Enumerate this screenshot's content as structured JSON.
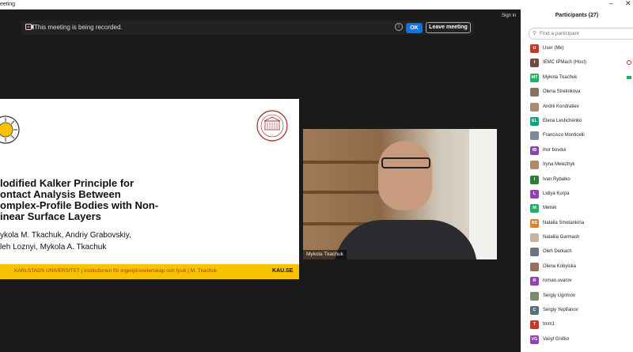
{
  "window": {
    "title": "eeting"
  },
  "toolbar": {
    "signin_label": "Sign in"
  },
  "recording_banner": {
    "text": "This meeting is being recorded.",
    "info_label": "i",
    "ok_label": "OK",
    "leave_label": "Leave meeting"
  },
  "slide": {
    "title": "lodified Kalker Principle for\nontact Analysis Between\nomplex-Profile Bodies with Non-\ninear Surface Layers",
    "authors": "ykola M. Tkachuk, Andriy Grabovskiy,\nleh Loznyi, Mykola A. Tkachuk",
    "footer_text": "KARLSTADS UNIVERSITET  |  Institutionen för ingenjörsvetenskap och fysik  |  M. Tkachuk",
    "footer_brand": "KAU.SE"
  },
  "video": {
    "name": "Mykola Tkachuk"
  },
  "participants": {
    "title": "Participants (27)",
    "search_placeholder": "Find a participant",
    "items": [
      {
        "initials": "U",
        "name": "User (Me)",
        "color": "#c0392b"
      },
      {
        "initials": "I",
        "name": "IEMC IPMach (Host)",
        "color": "#6d4c41"
      },
      {
        "initials": "MT",
        "name": "Mykola Tkachuk",
        "color": "#27ae60"
      },
      {
        "initials": "",
        "name": "Olena Strelnikova",
        "color": "#8e6f5a"
      },
      {
        "initials": "",
        "name": "Andrii Kondratiev",
        "color": "#a98c73"
      },
      {
        "initials": "EL",
        "name": "Elena Leshchenko",
        "color": "#16a085"
      },
      {
        "initials": "",
        "name": "Francisco Monticelli",
        "color": "#7b8a99"
      },
      {
        "initials": "IB",
        "name": "ihor bovdui",
        "color": "#8e44ad"
      },
      {
        "initials": "",
        "name": "Iryna Melezhyk",
        "color": "#b08968"
      },
      {
        "initials": "I",
        "name": "Ivan Rybalko",
        "color": "#2e7d32"
      },
      {
        "initials": "L",
        "name": "Lidiya Kurpa",
        "color": "#8e44ad"
      },
      {
        "initials": "M",
        "name": "Melnik",
        "color": "#27ae60"
      },
      {
        "initials": "NS",
        "name": "Natalia Smetankina",
        "color": "#e67e22"
      },
      {
        "initials": "",
        "name": "Nataliia Garmash",
        "color": "#c9b29b"
      },
      {
        "initials": "",
        "name": "Oleh Derkach",
        "color": "#6a7680"
      },
      {
        "initials": "",
        "name": "Olena Kobylska",
        "color": "#9a6f5a"
      },
      {
        "initials": "R",
        "name": "roman.uvarov",
        "color": "#8e44ad"
      },
      {
        "initials": "",
        "name": "Sergiy Ugrimov",
        "color": "#7a8c6b"
      },
      {
        "initials": "C",
        "name": "Sergiy Yepifanov",
        "color": "#546e7a"
      },
      {
        "initials": "T",
        "name": "tmm1",
        "color": "#c0392b"
      },
      {
        "initials": "VG",
        "name": "Vasyl Gnitko",
        "color": "#8e44ad"
      }
    ]
  },
  "colors": {
    "accent": "#0e72ed",
    "slide_footer": "#f7c200",
    "panel_bg": "#ffffff",
    "stage_bg": "#1a1a1a"
  }
}
